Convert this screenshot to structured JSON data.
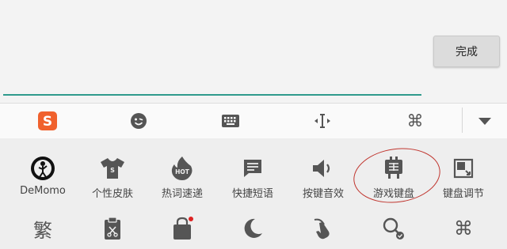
{
  "done_label": "完成",
  "toolbar": {
    "items": [
      "sogou-logo-icon",
      "emoji-icon",
      "keyboard-icon",
      "cursor-move-icon",
      "command-icon",
      "collapse-icon"
    ],
    "brand_color": "#f0612d"
  },
  "panel": {
    "row1": [
      {
        "label": "DeMomo",
        "icon": "demomo-avatar-icon"
      },
      {
        "label": "个性皮肤",
        "icon": "tshirt-icon"
      },
      {
        "label": "热词速递",
        "icon": "hot-flame-icon"
      },
      {
        "label": "快捷短语",
        "icon": "message-icon"
      },
      {
        "label": "按键音效",
        "icon": "speaker-icon"
      },
      {
        "label": "游戏键盘",
        "icon": "game-keyboard-icon"
      },
      {
        "label": "键盘调节",
        "icon": "resize-icon"
      }
    ],
    "row2": [
      {
        "icon": "traditional-char-icon",
        "glyph": "繁"
      },
      {
        "icon": "clipboard-icon"
      },
      {
        "icon": "shop-bag-icon"
      },
      {
        "icon": "moon-icon"
      },
      {
        "icon": "gesture-icon"
      },
      {
        "icon": "search-check-icon"
      },
      {
        "icon": "command-check-icon"
      }
    ]
  },
  "highlight_color": "#c0352e",
  "accent_line_color": "#2e9a8c"
}
